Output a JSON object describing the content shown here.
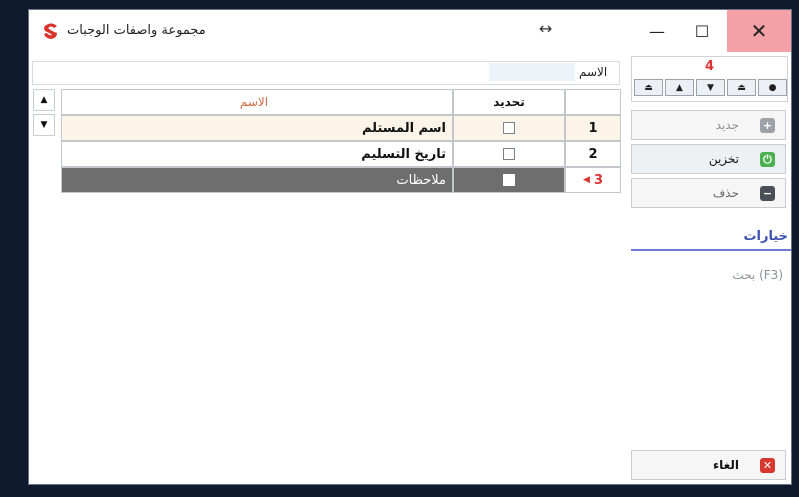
{
  "window": {
    "title": "مجموعة واصفات الوجبات",
    "move_glyph": "↔",
    "minimize_glyph": "—",
    "maximize_glyph": "☐",
    "close_glyph": "✕",
    "logo_icon": "app-logo-icon"
  },
  "navigator": {
    "record_number": "4",
    "buttons": [
      {
        "name": "first-record",
        "glyph": "⏏"
      },
      {
        "name": "previous-record",
        "glyph": "▲"
      },
      {
        "name": "next-record",
        "glyph": "▼"
      },
      {
        "name": "last-record",
        "glyph": "⏏"
      },
      {
        "name": "current-record",
        "glyph": "●"
      }
    ]
  },
  "search": {
    "label": "الاسم",
    "value": ""
  },
  "grid": {
    "headers": {
      "name": "الاسم",
      "select": "تحديد",
      "number": ""
    },
    "rows": [
      {
        "num": "1",
        "name": "اسم المستلم",
        "checked": false
      },
      {
        "num": "2",
        "name": "تاريخ التسليم",
        "checked": false
      },
      {
        "num": "3",
        "name": "ملاحظات",
        "checked": false,
        "selected": true
      }
    ],
    "scroll_up": "▲",
    "scroll_down": "▼"
  },
  "actions": {
    "new_label": "جديد",
    "save_label": "تخزين",
    "delete_label": "حذف",
    "cancel_label": "الغاء"
  },
  "options": {
    "title": "خيارات",
    "search_hint": "بحث (F3)"
  },
  "colors": {
    "close_hover": "#f3a0a6",
    "selected_row": "#6e6e6e",
    "accent_red": "#d33333",
    "options_accent": "#3b4fb5"
  }
}
